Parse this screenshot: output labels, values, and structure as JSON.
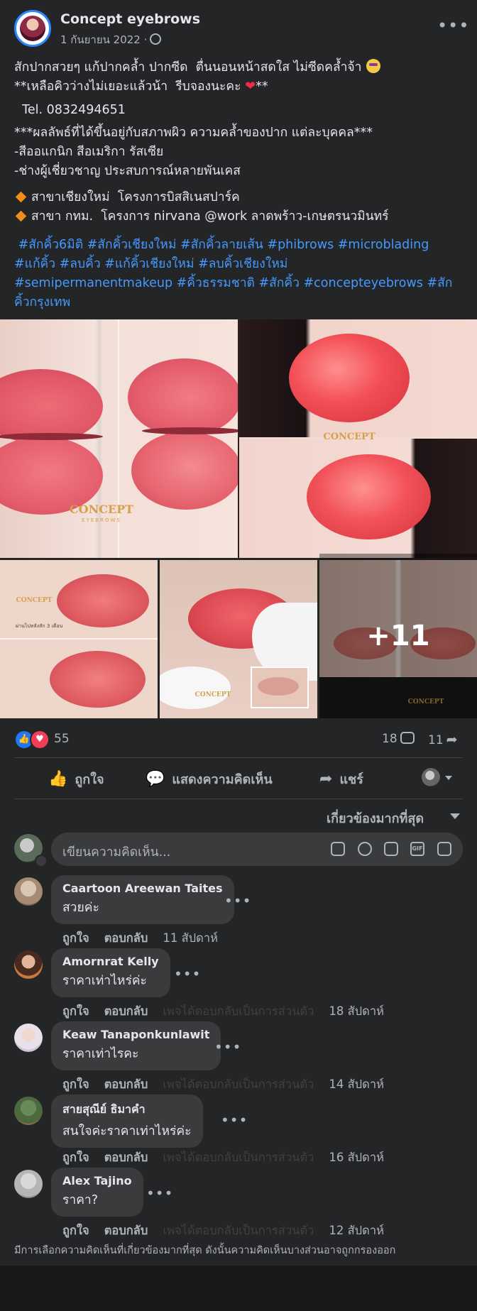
{
  "post": {
    "page_name": "Concept eyebrows",
    "date": "1 กันยายน 2022 ·",
    "more_label": "•••",
    "lines": [
      "สักปากสวยๆ แก้ปากคล้ำ ปากซีด  ตื่นนอนหน้าสดใส ไม่ซีดคล้ำจ้า",
      "**เหลือคิวว่างไม่เยอะแล้วน้า  รีบจองนะคะ",
      "  Tel. 0832494651",
      "***ผลลัพธ์ที่ได้ขึ้นอยู่กับสภาพผิว ความคล้ำของปาก แต่ละบุคคล***",
      "-สีออแกนิก สีอเมริกา รัสเซีย",
      "-ช่างผู้เชี่ยวชาญ ประสบการณ์หลายพันเคส",
      "สาขาเชียงใหม่  โครงการบิสสิเนสปาร์ค",
      "สาขา กทม.  โครงการ nirvana @work ลาดพร้าว-เกษตรนวมินทร์"
    ],
    "line2_suffix": "**",
    "hashtag_lines": [
      " #สักคิ้ว6มิติ #สักคิ้วเชียงใหม่ #สักคิ้วลายเส้น #phibrows #microblading",
      "#แก้คิ้ว #ลบคิ้ว #แก้คิ้วเชียงใหม่ #ลบคิ้วเชียงใหม่",
      "#semipermanentmakeup #คิ้วธรรมชาติ #สักคิ้ว #concepteyebrows #สัก",
      "คิ้วกรุงเทพ"
    ],
    "photo_more": "+11",
    "watermark": "CONCEPT",
    "watermark_sub": "EYEBROWS",
    "photo_caption": "ผ่านไปหลังสัก 3 เดือน"
  },
  "stats": {
    "reactions": "55",
    "comments": "18",
    "shares": "11"
  },
  "actions": {
    "like": "ถูกใจ",
    "comment": "แสดงความคิดเห็น",
    "share": "แชร์"
  },
  "sort": {
    "label": "เกี่ยวข้องมากที่สุด"
  },
  "comment_box": {
    "placeholder": "เขียนความคิดเห็น..."
  },
  "comments": [
    {
      "name": "Caartoon Areewan Taites",
      "text": "สวยค่ะ",
      "like": "ถูกใจ",
      "reply": "ตอบกลับ",
      "note": "",
      "time": "11 สัปดาห์"
    },
    {
      "name": "Amornrat Kelly",
      "text": "ราคาเท่าไหร่ค่ะ",
      "like": "ถูกใจ",
      "reply": "ตอบกลับ",
      "note": "เพจได้ตอบกลับเป็นการส่วนตัว",
      "time": "18 สัปดาห์"
    },
    {
      "name": "Keaw Tanaponkunlawit",
      "text": "ราคาเท่าไรคะ",
      "like": "ถูกใจ",
      "reply": "ตอบกลับ",
      "note": "เพจได้ตอบกลับเป็นการส่วนตัว",
      "time": "14 สัปดาห์"
    },
    {
      "name": "สายสุณีย์ ธิมาคำ",
      "text": "สนใจค่ะราคาเท่าไหร่ค่ะ",
      "like": "ถูกใจ",
      "reply": "ตอบกลับ",
      "note": "เพจได้ตอบกลับเป็นการส่วนตัว",
      "time": "16 สัปดาห์"
    },
    {
      "name": "Alex Tajino",
      "text": "ราคา?",
      "like": "ถูกใจ",
      "reply": "ตอบกลับ",
      "note": "เพจได้ตอบกลับเป็นการส่วนตัว",
      "time": "12 สัปดาห์"
    }
  ],
  "footer_note": "มีการเลือกความคิดเห็นที่เกี่ยวข้องมากที่สุด ดังนั้นความคิดเห็นบางส่วนอาจถูกกรองออก",
  "colors": {
    "background": "#18191a",
    "card": "#242526",
    "bubble": "#3a3b3c",
    "hashtag": "#4599ff",
    "like_blue": "#2078f4",
    "love_red": "#f33e58"
  },
  "icons": [
    "globe-icon",
    "more-icon",
    "like-icon",
    "comment-icon",
    "share-icon",
    "sticker-icon",
    "emoji-icon",
    "camera-icon",
    "gif-icon"
  ]
}
